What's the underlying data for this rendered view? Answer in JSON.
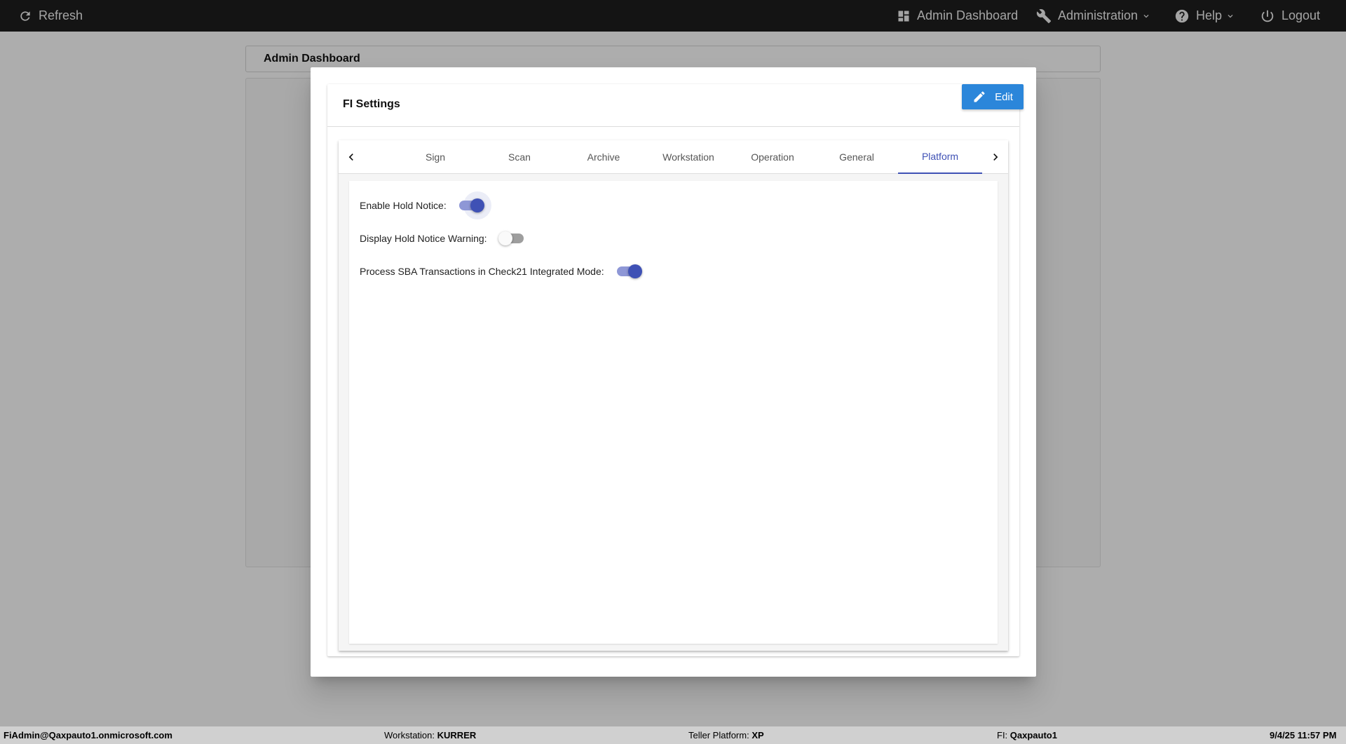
{
  "topbar": {
    "refresh_label": "Refresh",
    "admin_dashboard_label": "Admin Dashboard",
    "administration_label": "Administration",
    "help_label": "Help",
    "logout_label": "Logout"
  },
  "page": {
    "header_title": "Admin Dashboard"
  },
  "modal": {
    "title": "FI Settings",
    "edit_label": "Edit",
    "tabs": [
      {
        "label": "Sign"
      },
      {
        "label": "Scan"
      },
      {
        "label": "Archive"
      },
      {
        "label": "Workstation"
      },
      {
        "label": "Operation"
      },
      {
        "label": "General"
      },
      {
        "label": "Platform"
      }
    ],
    "active_tab": "Platform",
    "settings": [
      {
        "label": "Enable Hold Notice:",
        "enabled": true
      },
      {
        "label": "Display Hold Notice Warning:",
        "enabled": false
      },
      {
        "label": "Process SBA Transactions in Check21 Integrated Mode:",
        "enabled": true
      }
    ]
  },
  "footer": {
    "user": "FiAdmin@Qaxpauto1.onmicrosoft.com",
    "workstation_label": "Workstation:",
    "workstation_value": "KURRER",
    "teller_platform_label": "Teller Platform:",
    "teller_platform_value": "XP",
    "fi_label": "FI:",
    "fi_value": "Qaxpauto1",
    "datetime": "9/4/25 11:57 PM"
  },
  "colors": {
    "accent": "#3f51b5",
    "edit_button": "#2b86da",
    "topbar": "#1e1e1e"
  }
}
